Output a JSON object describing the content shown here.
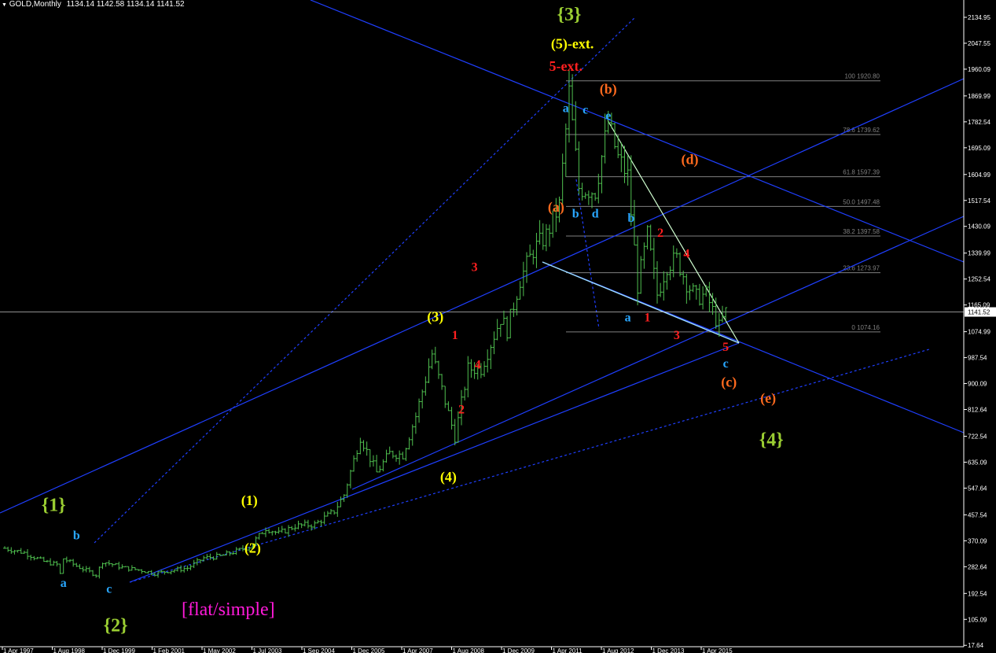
{
  "header": {
    "symbol": "GOLD,Monthly",
    "ohlc": "1134.14 1142.58 1134.14 1141.52"
  },
  "chart_data": {
    "type": "candlestick-ohlc",
    "title": "GOLD,Monthly",
    "ohlc_header": {
      "open": 1134.14,
      "high": 1142.58,
      "low": 1134.14,
      "close": 1141.52
    },
    "current_price": "1141.52",
    "ylim": [
      17.64,
      2170
    ],
    "price_axis_ticks": [
      "2134.95",
      "2047.55",
      "1960.09",
      "1869.99",
      "1782.54",
      "1695.09",
      "1604.99",
      "1517.54",
      "1430.09",
      "1339.99",
      "1252.54",
      "1165.09",
      "1074.99",
      "987.54",
      "900.09",
      "812.64",
      "722.54",
      "635.09",
      "547.64",
      "457.54",
      "370.09",
      "282.64",
      "192.54",
      "105.09",
      "17.64"
    ],
    "time_axis_ticks": [
      "1 Apr 1997",
      "1 Aug 1998",
      "1 Dec 1999",
      "1 Feb 2001",
      "1 May 2002",
      "1 Jul 2003",
      "1 Sep 2004",
      "1 Dec 2005",
      "1 Apr 2007",
      "1 Aug 2008",
      "1 Dec 2009",
      "1 Apr 2011",
      "1 Aug 2012",
      "1 Dec 2013",
      "1 Apr 2015"
    ],
    "fibonacci_levels": [
      {
        "label": "100 1920.80",
        "price": 1920.8
      },
      {
        "label": "78.6 1739.62",
        "price": 1739.62
      },
      {
        "label": "61.8 1597.39",
        "price": 1597.39
      },
      {
        "label": "50.0 1497.48",
        "price": 1497.48
      },
      {
        "label": "38.2 1397.58",
        "price": 1397.58
      },
      {
        "label": "23.6 1273.97",
        "price": 1273.97
      },
      {
        "label": "0 1074.16",
        "price": 1074.16
      }
    ],
    "price_path": [
      [
        "1997-04",
        345
      ],
      [
        "1997-10",
        330
      ],
      [
        "1998-04",
        300
      ],
      [
        "1998-08",
        290
      ],
      [
        "1998-09",
        258
      ],
      [
        "1998-10",
        310
      ],
      [
        "1999-02",
        285
      ],
      [
        "1999-08",
        255
      ],
      [
        "1999-10",
        300
      ],
      [
        "2000-04",
        280
      ],
      [
        "2000-10",
        270
      ],
      [
        "2001-02",
        260
      ],
      [
        "2001-06",
        268
      ],
      [
        "2001-12",
        278
      ],
      [
        "2002-05",
        312
      ],
      [
        "2002-10",
        318
      ],
      [
        "2003-03",
        335
      ],
      [
        "2003-07",
        350
      ],
      [
        "2003-12",
        412
      ],
      [
        "2004-04",
        395
      ],
      [
        "2004-09",
        420
      ],
      [
        "2005-03",
        425
      ],
      [
        "2005-09",
        470
      ],
      [
        "2005-12",
        525
      ],
      [
        "2006-05",
        720
      ],
      [
        "2006-10",
        600
      ],
      [
        "2007-02",
        665
      ],
      [
        "2007-06",
        660
      ],
      [
        "2007-10",
        790
      ],
      [
        "2008-03",
        1000
      ],
      [
        "2008-06",
        880
      ],
      [
        "2008-10",
        720
      ],
      [
        "2009-02",
        950
      ],
      [
        "2009-06",
        950
      ],
      [
        "2009-12",
        1120
      ],
      [
        "2010-02",
        1080
      ],
      [
        "2010-06",
        1250
      ],
      [
        "2010-10",
        1350
      ],
      [
        "2011-02",
        1400
      ],
      [
        "2011-06",
        1500
      ],
      [
        "2011-09",
        1880
      ],
      [
        "2011-12",
        1560
      ],
      [
        "2012-05",
        1550
      ],
      [
        "2012-09",
        1780
      ],
      [
        "2012-12",
        1660
      ],
      [
        "2013-03",
        1600
      ],
      [
        "2013-06",
        1230
      ],
      [
        "2013-09",
        1400
      ],
      [
        "2013-12",
        1200
      ],
      [
        "2014-03",
        1300
      ],
      [
        "2014-06",
        1320
      ],
      [
        "2014-09",
        1240
      ],
      [
        "2014-12",
        1190
      ],
      [
        "2015-03",
        1200
      ],
      [
        "2015-07",
        1090
      ],
      [
        "2015-09",
        1141.52
      ]
    ],
    "wave_labels": {
      "primary": [
        {
          "text": "{1}",
          "date": "1998-07",
          "price": 470,
          "color": "#9acd32"
        },
        {
          "text": "{2}",
          "date": "2000-02",
          "price": 65,
          "color": "#9acd32"
        },
        {
          "text": "{3}",
          "date": "2011-09",
          "price": 2125,
          "color": "#9acd32"
        },
        {
          "text": "{4}",
          "date": "2016-11",
          "price": 690,
          "color": "#9acd32"
        }
      ],
      "intermediate": [
        {
          "text": "(1)",
          "date": "2003-07",
          "price": 490,
          "color": "#ffff00"
        },
        {
          "text": "(2)",
          "date": "2003-08",
          "price": 330,
          "color": "#ffff00"
        },
        {
          "text": "(3)",
          "date": "2008-04",
          "price": 1110,
          "color": "#ffff00"
        },
        {
          "text": "(4)",
          "date": "2008-08",
          "price": 570,
          "color": "#ffff00"
        },
        {
          "text": "(5)-ext.",
          "date": "2011-10",
          "price": 2030,
          "color": "#ffff00"
        },
        {
          "text": "5-ext.",
          "date": "2011-08",
          "price": 1955,
          "color": "#ff2020"
        }
      ],
      "correction_orange": [
        {
          "text": "(a)",
          "date": "2011-05",
          "price": 1480,
          "color": "#ff6a1e"
        },
        {
          "text": "(b)",
          "date": "2012-09",
          "price": 1878,
          "color": "#ff6a1e"
        },
        {
          "text": "(c)",
          "date": "2015-10",
          "price": 890,
          "color": "#ff6a1e"
        },
        {
          "text": "(d)",
          "date": "2014-10",
          "price": 1640,
          "color": "#ff6a1e"
        },
        {
          "text": "(e)",
          "date": "2016-10",
          "price": 835,
          "color": "#ff6a1e"
        }
      ],
      "minor_cyan": [
        {
          "text": "a",
          "date": "1998-10",
          "price": 215,
          "color": "#29a7ff"
        },
        {
          "text": "b",
          "date": "1999-02",
          "price": 375,
          "color": "#29a7ff"
        },
        {
          "text": "c",
          "date": "1999-12",
          "price": 195,
          "color": "#29a7ff"
        },
        {
          "text": "a",
          "date": "2011-08",
          "price": 1815,
          "color": "#29a7ff"
        },
        {
          "text": "c",
          "date": "2012-02",
          "price": 1810,
          "color": "#29a7ff"
        },
        {
          "text": "b",
          "date": "2011-11",
          "price": 1460,
          "color": "#29a7ff"
        },
        {
          "text": "d",
          "date": "2012-05",
          "price": 1460,
          "color": "#29a7ff"
        },
        {
          "text": "e",
          "date": "2012-09",
          "price": 1790,
          "color": "#29a7ff"
        },
        {
          "text": "b",
          "date": "2013-04",
          "price": 1445,
          "color": "#29a7ff"
        },
        {
          "text": "a",
          "date": "2013-03",
          "price": 1110,
          "color": "#29a7ff"
        },
        {
          "text": "c",
          "date": "2015-09",
          "price": 955,
          "color": "#29a7ff"
        }
      ],
      "sub_red": [
        {
          "text": "1",
          "date": "2008-10",
          "price": 1050,
          "color": "#ff2020"
        },
        {
          "text": "2",
          "date": "2008-12",
          "price": 800,
          "color": "#ff2020"
        },
        {
          "text": "3",
          "date": "2009-04",
          "price": 1280,
          "color": "#ff2020"
        },
        {
          "text": "4",
          "date": "2009-05",
          "price": 950,
          "color": "#ff2020"
        },
        {
          "text": "1",
          "date": "2013-09",
          "price": 1110,
          "color": "#ff2020"
        },
        {
          "text": "2",
          "date": "2014-01",
          "price": 1395,
          "color": "#ff2020"
        },
        {
          "text": "3",
          "date": "2014-06",
          "price": 1050,
          "color": "#ff2020"
        },
        {
          "text": "4",
          "date": "2014-09",
          "price": 1325,
          "color": "#ff2020"
        },
        {
          "text": "5",
          "date": "2015-09",
          "price": 1010,
          "color": "#ff2020"
        }
      ]
    },
    "annotation": {
      "text": "[flat/simple]",
      "color": "#ff1ad9"
    },
    "colors": {
      "background": "#000000",
      "bars": "#4fc04f",
      "channel": "#1f3fff",
      "fib": "#808080",
      "axis": "#ffffff",
      "triangle_edge": "#d0ffd0",
      "current_line": "#c0c0c0"
    }
  }
}
